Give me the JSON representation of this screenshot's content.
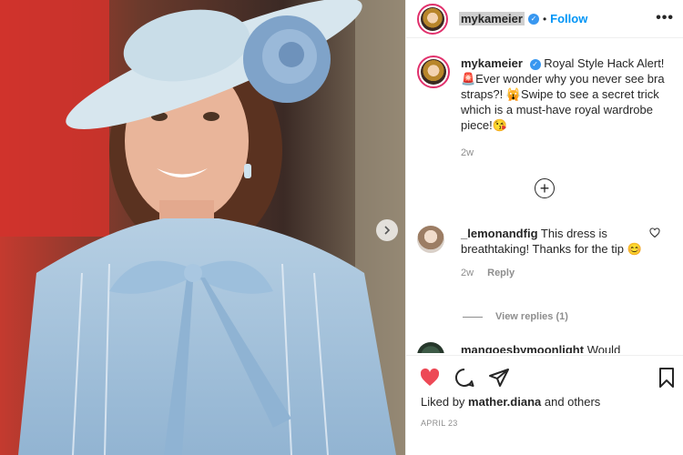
{
  "header": {
    "username": "mykameier",
    "separator": "•",
    "follow_label": "Follow",
    "more_label": "•••"
  },
  "caption": {
    "username": "mykameier",
    "text": "Royal Style Hack Alert! 🚨Ever wonder why you never see bra straps?! 🙀Swipe to see a secret trick which is a must-have royal wardrobe piece!😘",
    "time": "2w"
  },
  "comments": [
    {
      "username": "_lemonandfig",
      "text": "This dress is breathtaking! Thanks for the tip 😊",
      "time": "2w",
      "reply_label": "Reply",
      "view_replies": "View replies (1)"
    },
    {
      "username": "mangoesbymoonlight",
      "text": "Would"
    }
  ],
  "footer": {
    "likes_prefix": "Liked by",
    "liked_user": "mather.diana",
    "likes_suffix": "and others",
    "date": "APRIL 23"
  },
  "colors": {
    "accent": "#0095f6",
    "like_red": "#ed4956",
    "verified": "#3897f0"
  },
  "icons": [
    "verified-icon",
    "more-icon",
    "add-circle-icon",
    "heart-icon",
    "comment-icon",
    "share-icon",
    "bookmark-icon",
    "next-arrow-icon"
  ]
}
